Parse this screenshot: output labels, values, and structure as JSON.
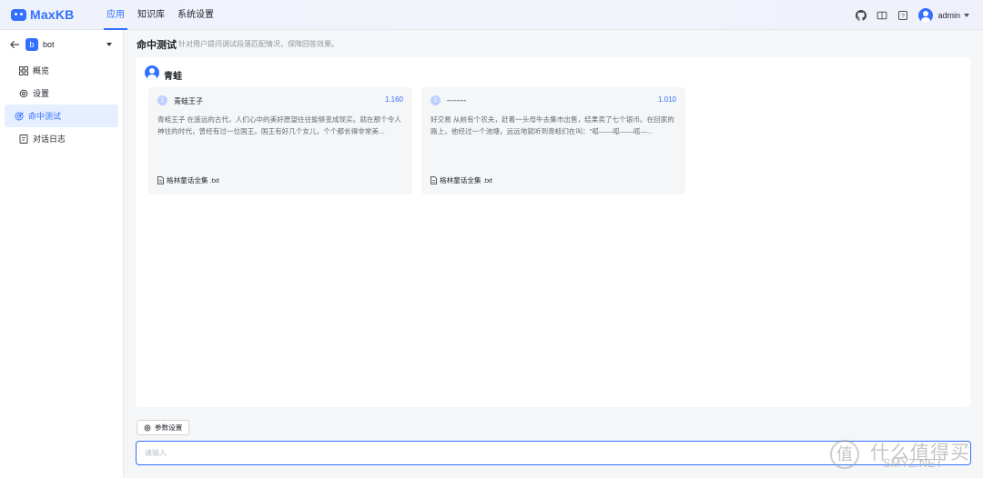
{
  "brand": {
    "name": "MaxKB"
  },
  "nav": [
    {
      "label": "应用",
      "active": true
    },
    {
      "label": "知识库",
      "active": false
    },
    {
      "label": "系统设置",
      "active": false
    }
  ],
  "user": {
    "name": "admin"
  },
  "sidebar": {
    "app_badge": "b",
    "app_name": "bot",
    "items": [
      {
        "label": "概览",
        "icon": "grid-icon",
        "active": false
      },
      {
        "label": "设置",
        "icon": "gear-icon",
        "active": false
      },
      {
        "label": "命中测试",
        "icon": "target-icon",
        "active": true
      },
      {
        "label": "对话日志",
        "icon": "document-icon",
        "active": false
      }
    ]
  },
  "page": {
    "title": "命中测试",
    "description": "针对用户提问调试段落匹配情况，保障回答效果。"
  },
  "query": {
    "text": "青蛙"
  },
  "results": [
    {
      "rank": "1",
      "title": "青蛙王子",
      "score": "1.160",
      "content": "青蛙王子 在遥远的古代，人们心中的美好愿望往往能够变成现实。就在那个令人神往的时代，曾经有过一位国王。国王有好几个女儿，个个都长得非常美...",
      "source": "格林童话全集 .txt"
    },
    {
      "rank": "2",
      "title": "--------",
      "score": "1.010",
      "content": "好交易 从前有个农夫，赶着一头母牛去集市出售，结果卖了七个银币。在回家的路上，他经过一个池塘，远远地就听到青蛙们在叫：\"呱——呱——呱—...",
      "source": "格林童话全集 .txt"
    }
  ],
  "params_button": {
    "label": "参数设置"
  },
  "input": {
    "placeholder": "请输入"
  },
  "watermark": {
    "main": "什么值得买",
    "sub": "SMYZ.NET",
    "logo": "值"
  },
  "colors": {
    "accent": "#3370ff",
    "active_bg": "#e6efff",
    "card_bg": "#f5f6f7"
  }
}
